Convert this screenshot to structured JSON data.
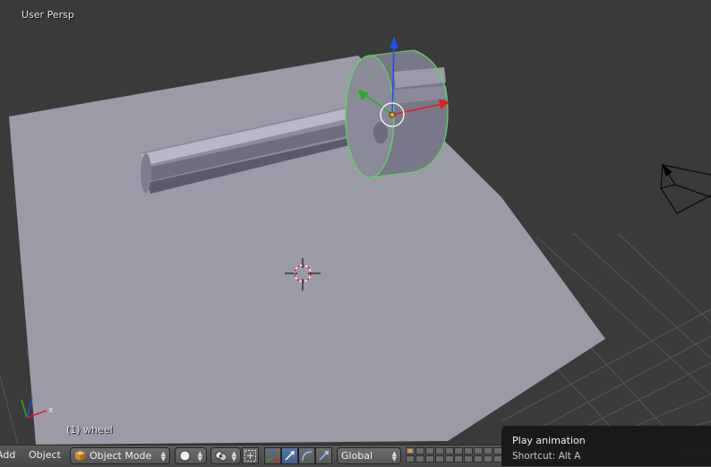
{
  "viewport": {
    "view_name": "User Persp",
    "active_object": "(1) wheel"
  },
  "header": {
    "menu_add": "Add",
    "menu_object": "Object",
    "mode": "Object Mode",
    "transform_orientation": "Global"
  },
  "tooltip": {
    "title": "Play animation",
    "shortcut": "Shortcut: Alt A"
  },
  "colors": {
    "viewport_bg": "#3a3a3a",
    "plane": "#9b9ba8",
    "selection_outline": "#55dd55",
    "axis_x": "#e02020",
    "axis_y": "#20b020",
    "axis_z": "#2050ee",
    "active_button": "#5677a8"
  },
  "icons": {
    "mode": "cube-icon",
    "shading": "solid-shading-icon",
    "pivot": "pivot-point-icon",
    "manipulator_toggle": "manipulator-toggle-icon",
    "translate": "translate-arrow-icon",
    "rotate": "rotate-arc-icon",
    "scale": "scale-icon"
  }
}
